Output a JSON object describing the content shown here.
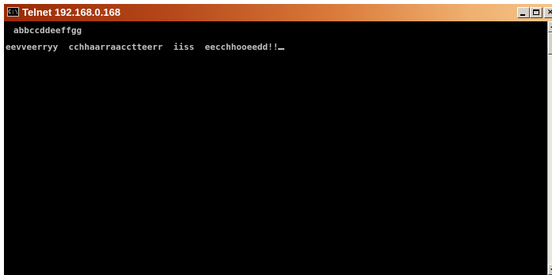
{
  "window": {
    "title": "Telnet 192.168.0.168",
    "icon": "console-icon",
    "icon_glyph": "C:\\",
    "buttons": {
      "minimize": "minimize-icon",
      "maximize": "maximize-icon",
      "close": "close-icon",
      "close_glyph": "×"
    }
  },
  "console": {
    "lines": [
      "abbccddeeffgg",
      "eevveerryy  cchhaarraacctteerr  iiss  eecchhooeedd!!"
    ],
    "text_color": "#c0c0c0",
    "background_color": "#000000"
  },
  "colors": {
    "titlebar_start": "#9a2a06",
    "titlebar_end": "#f4c48a",
    "chrome": "#d4d0c8"
  }
}
